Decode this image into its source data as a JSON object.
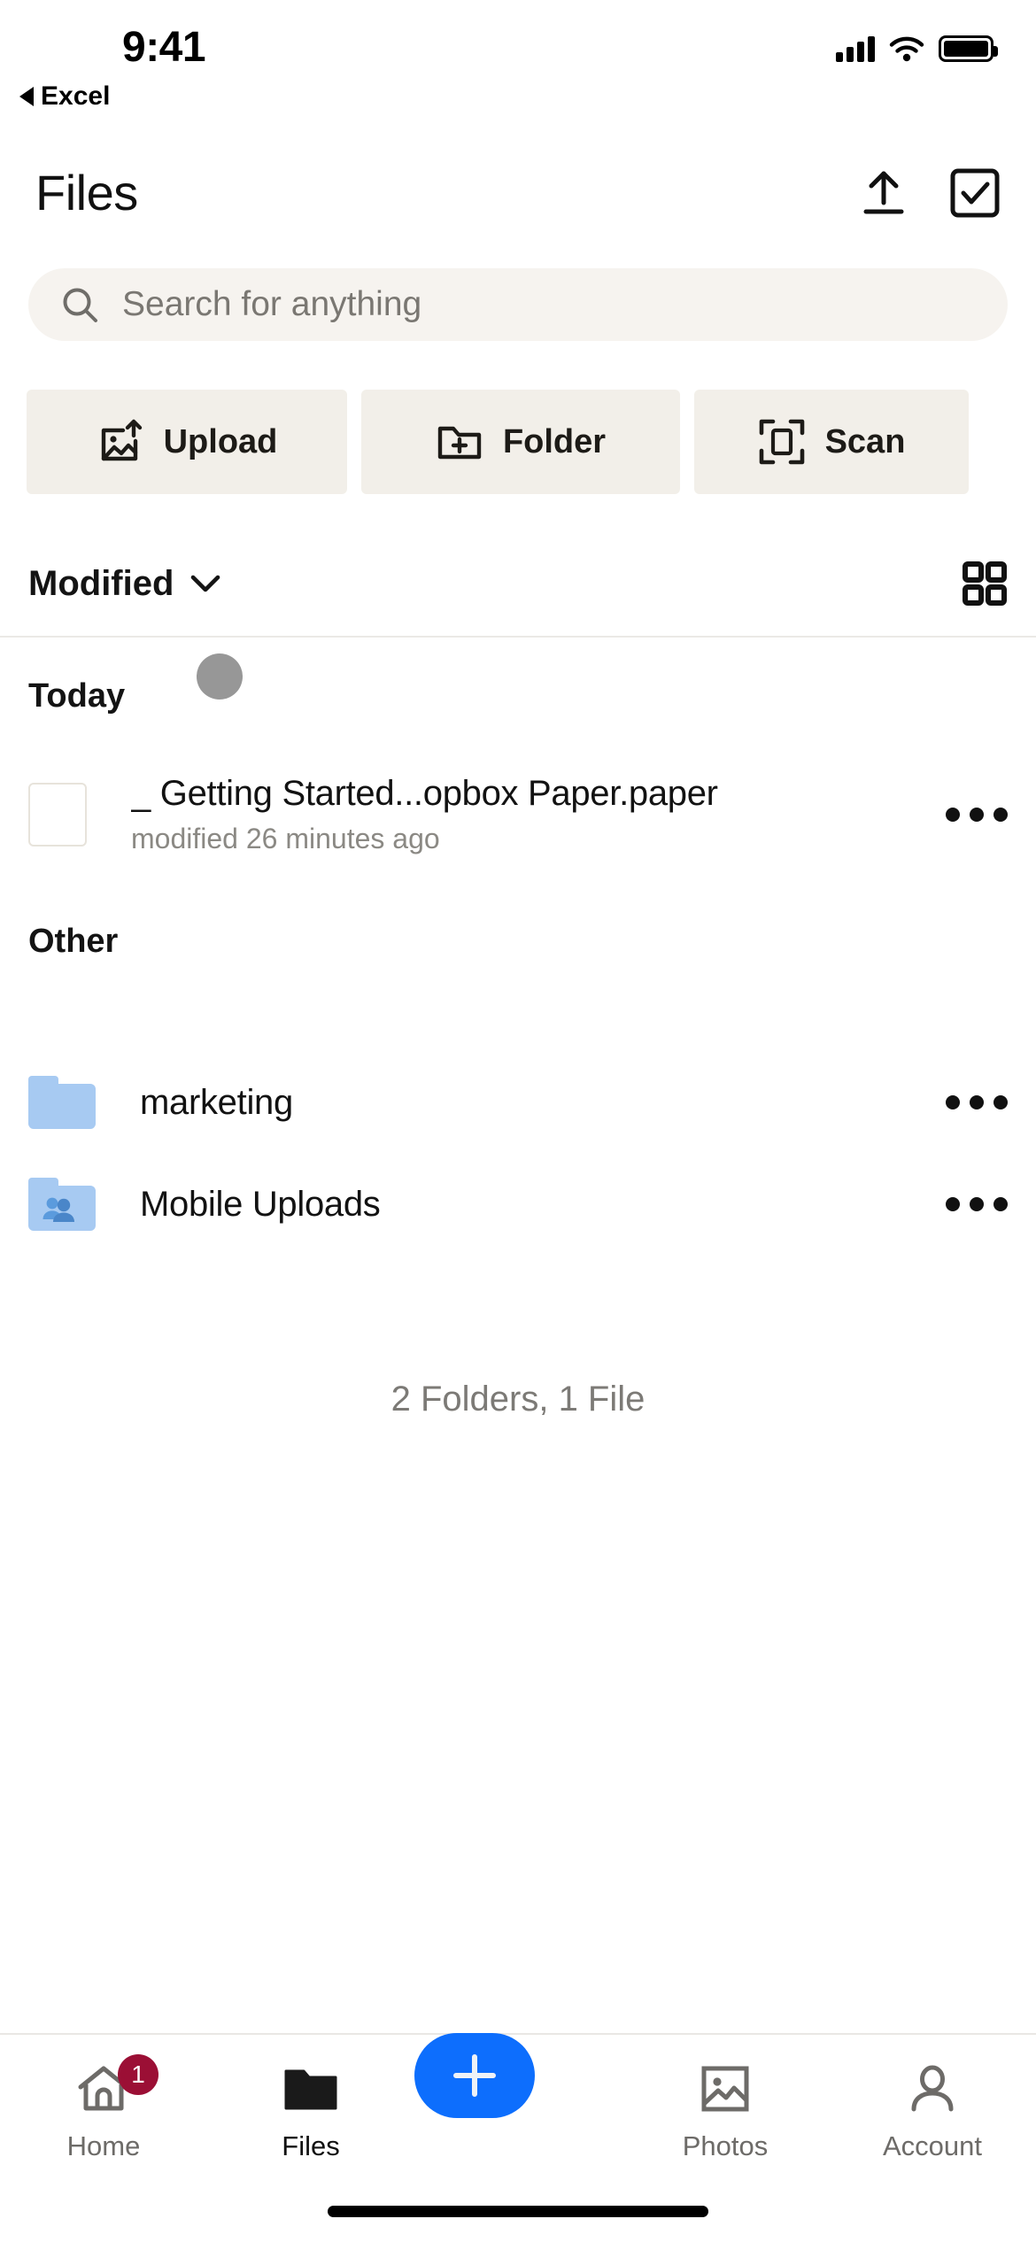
{
  "status_bar": {
    "time": "9:41",
    "back_to_app_label": "Excel",
    "icons": [
      "cellular-signal-icon",
      "wifi-icon",
      "battery-icon"
    ]
  },
  "header": {
    "title": "Files",
    "upload_icon": "upload-icon",
    "select_icon": "select-checkbox-icon"
  },
  "search": {
    "placeholder": "Search for anything",
    "value": "",
    "icon": "search-icon"
  },
  "quick_actions": [
    {
      "label": "Upload",
      "icon": "image-upload-icon"
    },
    {
      "label": "Folder",
      "icon": "folder-plus-icon"
    },
    {
      "label": "Scan",
      "icon": "scan-document-icon"
    }
  ],
  "sort_bar": {
    "label": "Modified",
    "chevron_icon": "chevron-down-icon",
    "view_toggle_icon": "grid-view-icon"
  },
  "sections": [
    {
      "title": "Today",
      "items": [
        {
          "name": "_ Getting Started...opbox Paper.paper",
          "subtitle": "modified 26 minutes ago",
          "icon": "paper-document-thumbnail",
          "overflow_icon": "more-options-icon"
        }
      ]
    },
    {
      "title": "Other",
      "items": [
        {
          "name": "marketing",
          "subtitle": "",
          "icon": "folder-icon",
          "overflow_icon": "more-options-icon"
        },
        {
          "name": "Mobile Uploads",
          "subtitle": "",
          "icon": "shared-folder-icon",
          "overflow_icon": "more-options-icon"
        }
      ]
    }
  ],
  "summary": "2 Folders, 1 File",
  "tab_bar": {
    "tabs": [
      {
        "label": "Home",
        "icon": "home-icon",
        "badge": "1",
        "active": false
      },
      {
        "label": "Files",
        "icon": "folder-filled-icon",
        "badge": "",
        "active": true
      },
      {
        "label": "Photos",
        "icon": "photos-icon",
        "badge": "",
        "active": false
      },
      {
        "label": "Account",
        "icon": "person-icon",
        "badge": "",
        "active": false
      }
    ],
    "create_button": {
      "label": "+",
      "icon": "plus-icon"
    }
  },
  "colors": {
    "accent_blue": "#0d6efd",
    "badge_red": "#9b0f35",
    "action_beige": "#f2efe9",
    "search_bg": "#f6f3ef",
    "folder_blue": "#a7caf2"
  }
}
